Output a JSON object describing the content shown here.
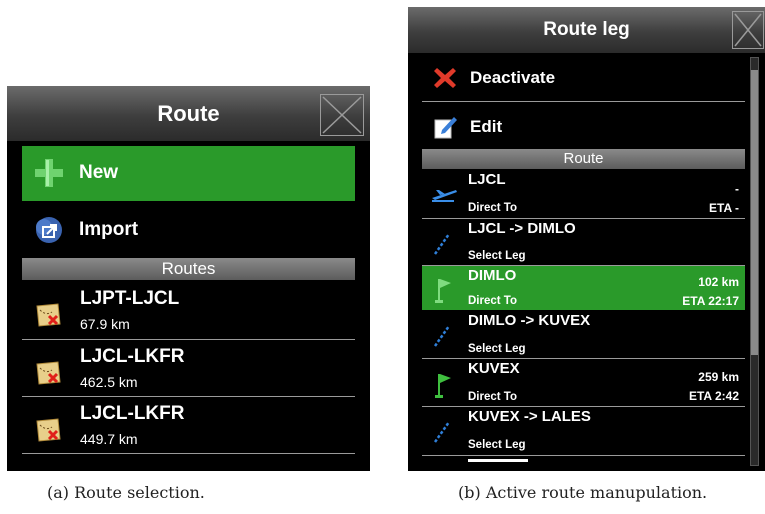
{
  "panel_a": {
    "title": "Route",
    "menu": {
      "new_label": "New",
      "import_label": "Import"
    },
    "section_label": "Routes",
    "routes": [
      {
        "name": "LJPT-LJCL",
        "distance": "67.9 km"
      },
      {
        "name": "LJCL-LKFR",
        "distance": "462.5 km"
      },
      {
        "name": "LJCL-LKFR",
        "distance": "449.7 km"
      }
    ],
    "caption": "(a) Route selection."
  },
  "panel_b": {
    "title": "Route leg",
    "menu": {
      "deactivate_label": "Deactivate",
      "edit_label": "Edit"
    },
    "section_label": "Route",
    "items": [
      {
        "name": "LJCL",
        "sub": "Direct To",
        "right_top": "-",
        "right_bottom": "ETA -",
        "icon": "airport-icon"
      },
      {
        "name": "LJCL -> DIMLO",
        "sub": "Select Leg",
        "right_top": "",
        "right_bottom": "",
        "icon": "leg-icon"
      },
      {
        "name": "DIMLO",
        "sub": "Direct To",
        "right_top": "102 km",
        "right_bottom": "ETA 22:17",
        "icon": "flag-icon",
        "active": true
      },
      {
        "name": "DIMLO -> KUVEX",
        "sub": "Select Leg",
        "right_top": "",
        "right_bottom": "",
        "icon": "leg-icon"
      },
      {
        "name": "KUVEX",
        "sub": "Direct To",
        "right_top": "259 km",
        "right_bottom": "ETA 2:42",
        "icon": "flag-icon"
      },
      {
        "name": "KUVEX -> LALES",
        "sub": "Select Leg",
        "right_top": "",
        "right_bottom": "",
        "icon": "leg-icon"
      }
    ],
    "caption": "(b) Active route manupulation."
  },
  "colors": {
    "active_green": "#2a9a2a",
    "panel_bg": "#000000",
    "accent_blue": "#2f7fd8"
  }
}
